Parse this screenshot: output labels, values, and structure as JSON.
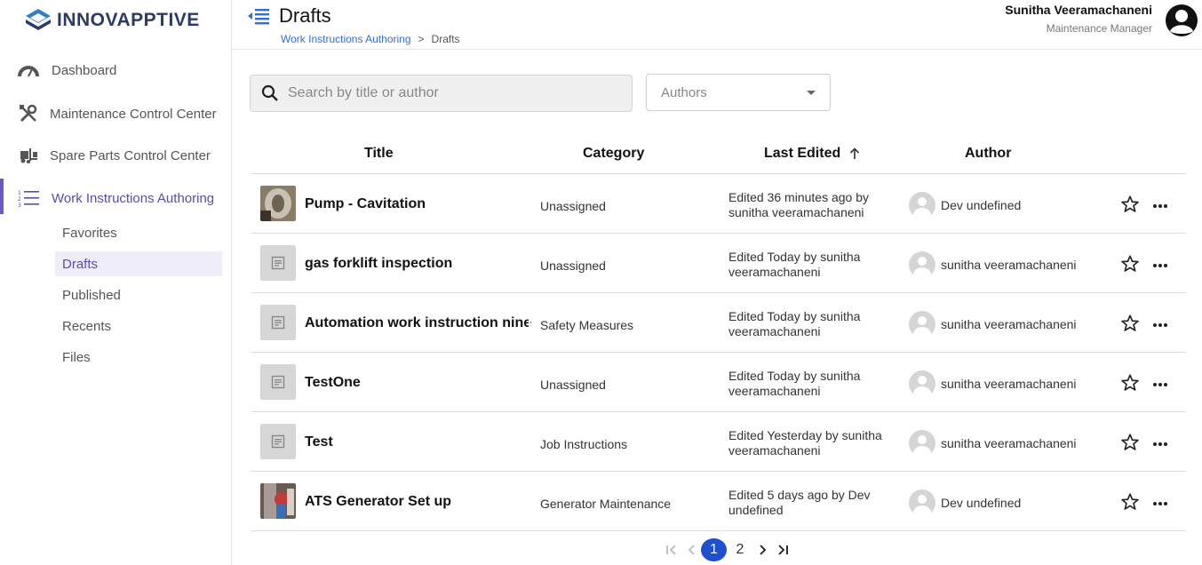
{
  "brand": {
    "name": "INNOVAPPTIVE"
  },
  "sidebar": {
    "items": [
      {
        "label": "Dashboard",
        "icon": "speedometer-icon"
      },
      {
        "label": "Maintenance Control Center",
        "icon": "tools-icon"
      },
      {
        "label": "Spare Parts Control Center",
        "icon": "forklift-icon"
      },
      {
        "label": "Work Instructions Authoring",
        "icon": "numbered-list-icon",
        "active": true
      }
    ],
    "subitems": [
      {
        "label": "Favorites"
      },
      {
        "label": "Drafts",
        "active": true
      },
      {
        "label": "Published"
      },
      {
        "label": "Recents"
      },
      {
        "label": "Files"
      }
    ]
  },
  "header": {
    "title": "Drafts",
    "breadcrumb": {
      "parent": "Work Instructions Authoring",
      "separator": ">",
      "current": "Drafts"
    },
    "user": {
      "name": "Sunitha Veeramachaneni",
      "role": "Maintenance Manager"
    }
  },
  "filters": {
    "search_placeholder": "Search by title or author",
    "authors_label": "Authors"
  },
  "table": {
    "columns": {
      "title": "Title",
      "category": "Category",
      "last_edited": "Last Edited",
      "author": "Author"
    },
    "sort": {
      "column": "Last Edited",
      "direction": "ascending"
    },
    "rows": [
      {
        "title": "Pump - Cavitation",
        "category": "Unassigned",
        "edited": "Edited 36 minutes ago by sunitha veeramachaneni",
        "author": "Dev undefined",
        "thumb": "photo-pump"
      },
      {
        "title": "gas forklift inspection",
        "category": "Unassigned",
        "edited": "Edited Today by sunitha veeramachaneni",
        "author": "sunitha veeramachaneni",
        "thumb": "document"
      },
      {
        "title": "Automation work instruction nine",
        "category": "Safety Measures",
        "edited": "Edited Today by sunitha veeramachaneni",
        "author": "sunitha veeramachaneni",
        "thumb": "document"
      },
      {
        "title": "TestOne",
        "category": "Unassigned",
        "edited": "Edited Today by sunitha veeramachaneni",
        "author": "sunitha veeramachaneni",
        "thumb": "document"
      },
      {
        "title": "Test",
        "category": "Job Instructions",
        "edited": "Edited Yesterday by sunitha veeramachaneni",
        "author": "sunitha veeramachaneni",
        "thumb": "document"
      },
      {
        "title": "ATS Generator Set up",
        "category": "Generator Maintenance",
        "edited": "Edited 5 days ago by Dev undefined",
        "author": "Dev undefined",
        "thumb": "photo-generator"
      }
    ]
  },
  "pagination": {
    "pages": [
      "1",
      "2"
    ],
    "current": "1"
  },
  "colors": {
    "accent": "#5a4cb0",
    "link": "#2f6fd6",
    "page_current": "#1d4fcf",
    "brand": "#2b3a67"
  }
}
